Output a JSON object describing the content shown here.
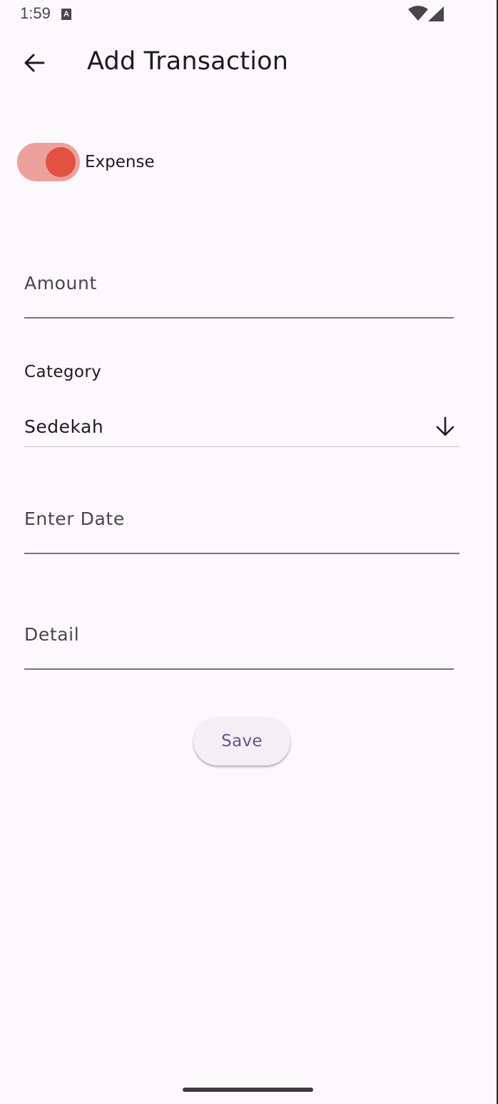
{
  "status_bar": {
    "time": "1:59",
    "notification_icon_letter": "A"
  },
  "app_bar": {
    "title": "Add Transaction",
    "back_icon": "arrow-back-icon"
  },
  "toggle": {
    "label": "Expense",
    "on": true,
    "track_color": "#eca19c",
    "thumb_color": "#e35141"
  },
  "form": {
    "amount_placeholder": "Amount",
    "category_label": "Category",
    "category_value": "Sedekah",
    "date_placeholder": "Enter Date",
    "detail_placeholder": "Detail"
  },
  "save_button": {
    "label": "Save",
    "text_color": "#65558f"
  }
}
